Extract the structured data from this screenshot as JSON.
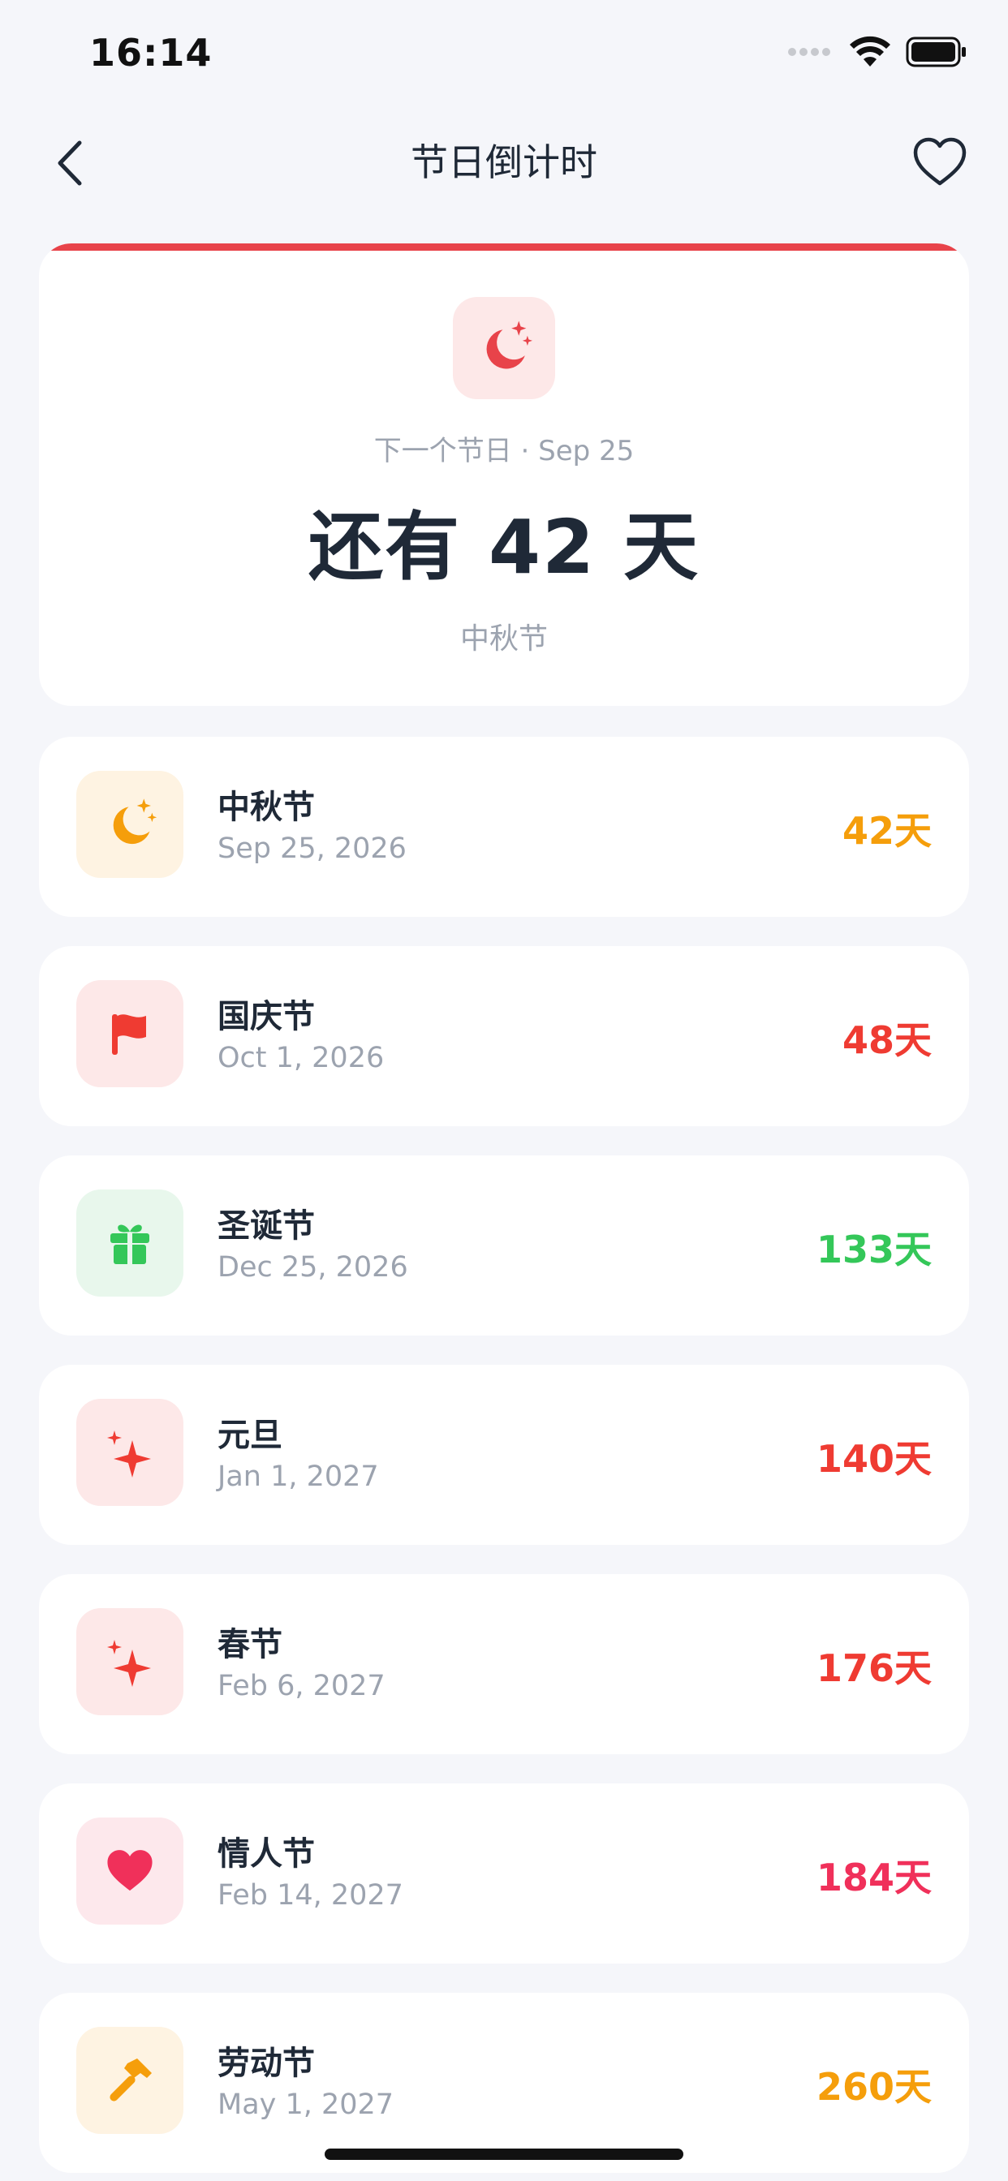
{
  "status": {
    "time": "16:14"
  },
  "nav": {
    "title": "节日倒计时"
  },
  "hero": {
    "subtitle": "下一个节日 · Sep 25",
    "countdown": "还有 42 天",
    "name": "中秋节",
    "accent": "#E8434A",
    "icon": "moon-stars-icon"
  },
  "holidays": [
    {
      "name": "中秋节",
      "date": "Sep 25, 2026",
      "days": "42天",
      "color": "#F59E0B",
      "bg": "#FEF3E2",
      "icon": "moon-stars-icon"
    },
    {
      "name": "国庆节",
      "date": "Oct 1, 2026",
      "days": "48天",
      "color": "#EF3B32",
      "bg": "#FDE8E8",
      "icon": "flag-icon"
    },
    {
      "name": "圣诞节",
      "date": "Dec 25, 2026",
      "days": "133天",
      "color": "#34C759",
      "bg": "#E8F7EC",
      "icon": "gift-icon"
    },
    {
      "name": "元旦",
      "date": "Jan 1, 2027",
      "days": "140天",
      "color": "#EF3B32",
      "bg": "#FDE8E8",
      "icon": "sparkles-icon"
    },
    {
      "name": "春节",
      "date": "Feb 6, 2027",
      "days": "176天",
      "color": "#EF3B32",
      "bg": "#FDE8E8",
      "icon": "sparkles-icon"
    },
    {
      "name": "情人节",
      "date": "Feb 14, 2027",
      "days": "184天",
      "color": "#F0305A",
      "bg": "#FDE8EC",
      "icon": "heart-icon"
    },
    {
      "name": "劳动节",
      "date": "May 1, 2027",
      "days": "260天",
      "color": "#F59E0B",
      "bg": "#FEF3E2",
      "icon": "hammer-icon"
    }
  ]
}
